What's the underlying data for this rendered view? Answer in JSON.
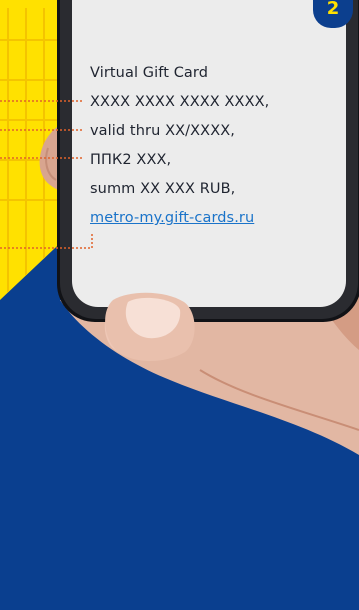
{
  "step": {
    "number": "2"
  },
  "sms": {
    "title": "Virtual Gift Card",
    "card_number": "XXXX XXXX XXXX XXXX,",
    "valid_thru": "valid thru XX/XXXX,",
    "pin": "ППК2 XXX,",
    "sum": "summ XX XXX RUB,",
    "link": "metro-my.gift-cards.ru"
  },
  "colors": {
    "background_blue": "#0a3f8f",
    "card_yellow": "#ffe100",
    "dotted_lines": "#e0622a",
    "link": "#1a73c9"
  }
}
